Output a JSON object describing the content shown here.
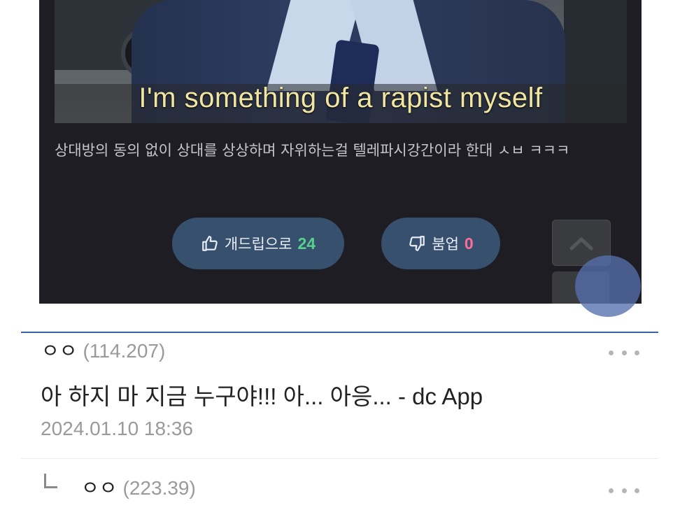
{
  "post": {
    "image_caption": "I'm something of a rapist myself",
    "body_text": "상대방의 동의 없이 상대를 상상하며 자위하는걸 텔레파시강간이라 한대 ㅅㅂ ㅋㅋㅋ",
    "upvote": {
      "label": "개드립으로",
      "count": "24",
      "icon": "thumbs-up-icon"
    },
    "downvote": {
      "label": "붐업",
      "count": "0",
      "icon": "thumbs-down-icon"
    }
  },
  "comments": [
    {
      "author": "ㅇㅇ",
      "ip": "(114.207)",
      "text": "아 하지 마 지금 누구야!!! 아... 아응... - dc App",
      "date": "2024.01.10 18:36"
    },
    {
      "reply_marker": "ㄴ",
      "author": "ㅇㅇ",
      "ip": "(223.39)"
    }
  ],
  "colors": {
    "card_bg": "#1e1d23",
    "vote_button": "#37506e",
    "upvote_count": "#57d18b",
    "downvote_count": "#ff6b9d",
    "accent_divider": "#3b62a8"
  }
}
